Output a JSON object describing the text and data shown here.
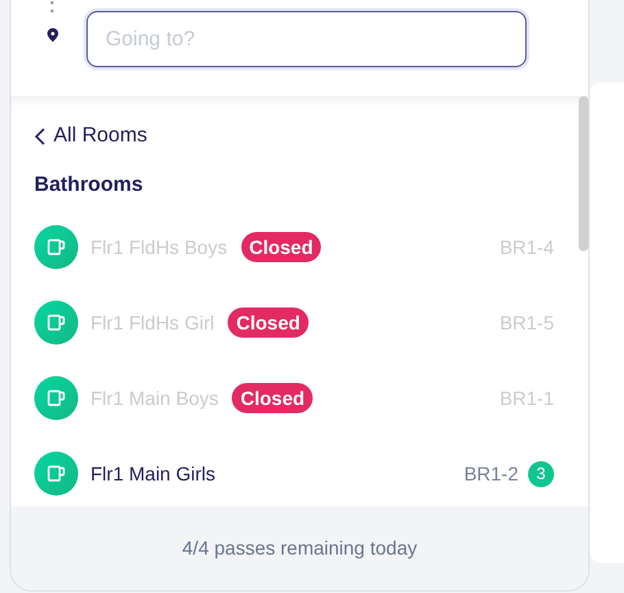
{
  "destination": {
    "placeholder": "Going to?"
  },
  "back_link": "All Rooms",
  "section_title": "Bathrooms",
  "rooms": [
    {
      "name": "Flr1 FldHs Boys",
      "closed": true,
      "closed_label": "Closed",
      "code": "BR1-4"
    },
    {
      "name": "Flr1 FldHs Girl",
      "closed": true,
      "closed_label": "Closed",
      "code": "BR1-5"
    },
    {
      "name": "Flr1 Main Boys",
      "closed": true,
      "closed_label": "Closed",
      "code": "BR1-1"
    },
    {
      "name": "Flr1 Main Girls",
      "closed": false,
      "code": "BR1-2",
      "count": "3"
    }
  ],
  "footer": "4/4 passes remaining today"
}
